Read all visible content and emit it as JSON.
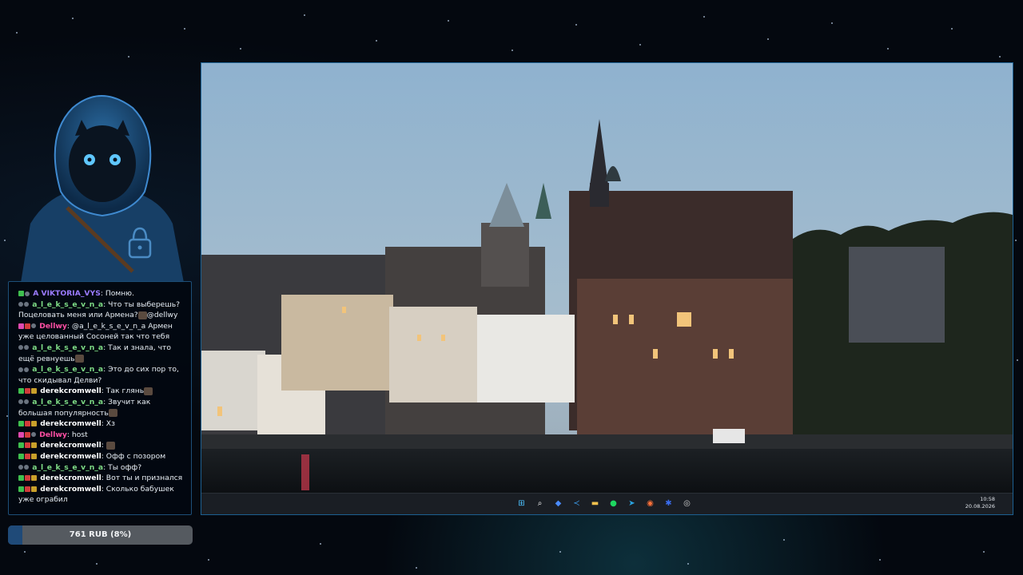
{
  "chat": {
    "messages": [
      {
        "nick": "A VIKTORIA_VYS",
        "nick_color": "#9b7bff",
        "badges": [
          "green",
          "grey"
        ],
        "text": "Помню."
      },
      {
        "nick": "a_l_e_k_s_e_v_n_a",
        "nick_color": "#7fdc86",
        "badges": [
          "grey",
          "grey"
        ],
        "text": "Что ты выберешь? Поцеловать меня или Армена?",
        "after_emote_text": "@dellwy",
        "emote": true
      },
      {
        "nick": "Dellwy",
        "nick_color": "#ff4fa3",
        "badges": [
          "pink",
          "red",
          "grey"
        ],
        "text": "@a_l_e_k_s_e_v_n_a Армен уже целованный Сосоней так что тебя"
      },
      {
        "nick": "a_l_e_k_s_e_v_n_a",
        "nick_color": "#7fdc86",
        "badges": [
          "grey",
          "grey"
        ],
        "text": "Так и знала, что ещё ревнуешь",
        "emote": true
      },
      {
        "nick": "a_l_e_k_s_e_v_n_a",
        "nick_color": "#7fdc86",
        "badges": [
          "grey",
          "grey"
        ],
        "text": "Это до сих пор то, что скидывал Делви?"
      },
      {
        "nick": "derekcromwell",
        "nick_color": "#ffffff",
        "badges": [
          "green",
          "red",
          "gold"
        ],
        "text": "Так глянь",
        "emote": true
      },
      {
        "nick": "a_l_e_k_s_e_v_n_a",
        "nick_color": "#7fdc86",
        "badges": [
          "grey",
          "grey"
        ],
        "text": "Звучит как большая популярность",
        "emote": true
      },
      {
        "nick": "derekcromwell",
        "nick_color": "#ffffff",
        "badges": [
          "green",
          "red",
          "gold"
        ],
        "text": "Хз"
      },
      {
        "nick": "Dellwy",
        "nick_color": "#ff4fa3",
        "badges": [
          "pink",
          "red",
          "grey"
        ],
        "text": "host"
      },
      {
        "nick": "derekcromwell",
        "nick_color": "#ffffff",
        "badges": [
          "green",
          "red",
          "gold"
        ],
        "text": "",
        "emote": true
      },
      {
        "nick": "derekcromwell",
        "nick_color": "#ffffff",
        "badges": [
          "green",
          "red",
          "gold"
        ],
        "text": "Офф с позором"
      },
      {
        "nick": "a_l_e_k_s_e_v_n_a",
        "nick_color": "#7fdc86",
        "badges": [
          "grey",
          "grey"
        ],
        "text": "Ты офф?"
      },
      {
        "nick": "derekcromwell",
        "nick_color": "#ffffff",
        "badges": [
          "green",
          "red",
          "gold"
        ],
        "text": "Вот ты и признался"
      },
      {
        "nick": "derekcromwell",
        "nick_color": "#ffffff",
        "badges": [
          "green",
          "red",
          "gold"
        ],
        "text": "Сколько бабушек уже ограбил"
      }
    ]
  },
  "donation": {
    "label": "761 RUB (8%)",
    "progress": 0.08
  },
  "taskbar": {
    "time": "10:58",
    "date": "20.08.2026",
    "icons": [
      {
        "name": "windows-start-icon",
        "color": "#4cc2ff",
        "glyph": "⊞"
      },
      {
        "name": "search-icon",
        "color": "#ffffff",
        "glyph": "⌕"
      },
      {
        "name": "app-icon-1",
        "color": "#4a8bff",
        "glyph": "◆"
      },
      {
        "name": "vscode-icon",
        "color": "#3c9be8",
        "glyph": "≺"
      },
      {
        "name": "file-explorer-icon",
        "color": "#f2c14e",
        "glyph": "▬"
      },
      {
        "name": "spotify-icon",
        "color": "#1ed760",
        "glyph": "●"
      },
      {
        "name": "telegram-icon",
        "color": "#2aa3e0",
        "glyph": "➤"
      },
      {
        "name": "firefox-icon",
        "color": "#ff7139",
        "glyph": "◉"
      },
      {
        "name": "app-icon-2",
        "color": "#3a6df0",
        "glyph": "✱"
      },
      {
        "name": "obs-icon",
        "color": "#d0d0d0",
        "glyph": "◎"
      }
    ]
  }
}
